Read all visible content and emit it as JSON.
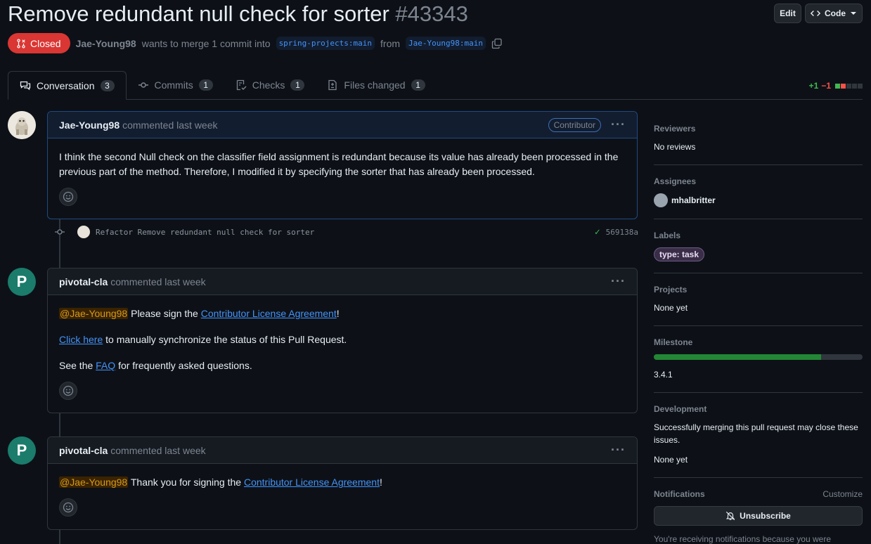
{
  "header": {
    "title": "Remove redundant null check for sorter",
    "number": "#43343",
    "edit_label": "Edit",
    "code_label": "Code"
  },
  "meta": {
    "state": "Closed",
    "author": "Jae-Young98",
    "text_mid": "wants to merge 1 commit into",
    "base_branch": "spring-projects:main",
    "text_from": "from",
    "head_branch": "Jae-Young98:main"
  },
  "tabs": [
    {
      "label": "Conversation",
      "count": "3"
    },
    {
      "label": "Commits",
      "count": "1"
    },
    {
      "label": "Checks",
      "count": "1"
    },
    {
      "label": "Files changed",
      "count": "1"
    }
  ],
  "diffstat": {
    "additions": "+1",
    "deletions": "−1"
  },
  "comments": [
    {
      "author": "Jae-Young98",
      "action": "commented last week",
      "badge": "Contributor",
      "body": "I think the second Null check on the classifier field assignment is redundant because its value has already been processed in the previous part of the method. Therefore, I modified it by specifying the sorter that has already been processed."
    },
    {
      "author": "pivotal-cla",
      "action": "commented last week",
      "mention": "@Jae-Young98",
      "p1_text": "Please sign the",
      "p1_link": "Contributor License Agreement",
      "p1_end": "!",
      "p2_link": "Click here",
      "p2_text": "to manually synchronize the status of this Pull Request.",
      "p3_text": "See the",
      "p3_link": "FAQ",
      "p3_end": "for frequently asked questions."
    },
    {
      "author": "pivotal-cla",
      "action": "commented last week",
      "mention": "@Jae-Young98",
      "text": "Thank you for signing the",
      "link": "Contributor License Agreement",
      "end": "!"
    }
  ],
  "commit": {
    "message": "Refactor Remove redundant null check for sorter",
    "sha": "569138a"
  },
  "sidebar": {
    "reviewers_title": "Reviewers",
    "reviewers_value": "No reviews",
    "assignees_title": "Assignees",
    "assignee": "mhalbritter",
    "labels_title": "Labels",
    "label": "type: task",
    "projects_title": "Projects",
    "projects_value": "None yet",
    "milestone_title": "Milestone",
    "milestone_value": "3.4.1",
    "milestone_progress": 0.8,
    "development_title": "Development",
    "development_text": "Successfully merging this pull request may close these issues.",
    "development_value": "None yet",
    "notifications_title": "Notifications",
    "customize_label": "Customize",
    "unsubscribe_label": "Unsubscribe",
    "notifications_footer": "You're receiving notifications because you were"
  }
}
